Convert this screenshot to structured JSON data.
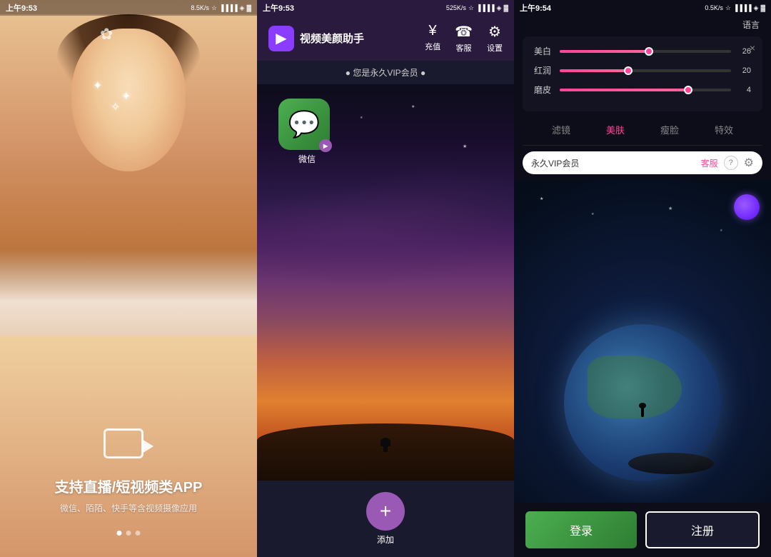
{
  "panel1": {
    "status_time": "上午9:53",
    "status_info": "8.5K/s",
    "title": "支持直播/短视频类APP",
    "subtitle": "微信、陌陌、快手等含视频摄像应用",
    "dots": [
      true,
      false,
      false
    ],
    "video_icon": "▶"
  },
  "panel2": {
    "status_time": "上午9:53",
    "status_info": "525K/s",
    "app_name": "视频美颜助手",
    "logo_icon": "▶",
    "actions": [
      {
        "icon": "¥",
        "label": "充值"
      },
      {
        "icon": "☎",
        "label": "客服"
      },
      {
        "icon": "⚙",
        "label": "设置"
      }
    ],
    "vip_text": "● 您是永久VIP会员 ●",
    "wechat_label": "微信",
    "add_label": "添加",
    "add_icon": "+"
  },
  "panel3": {
    "status_time": "上午9:54",
    "status_info": "0.5K/s",
    "lang": "语言",
    "close_icon": "×",
    "sliders": [
      {
        "label": "美白",
        "value": 26,
        "percent": 52
      },
      {
        "label": "红润",
        "value": 20,
        "percent": 40
      },
      {
        "label": "磨皮",
        "value": 4,
        "percent": 75
      }
    ],
    "tabs": [
      {
        "label": "滤镜",
        "active": false
      },
      {
        "label": "美肤",
        "active": true
      },
      {
        "label": "瘦脸",
        "active": false
      },
      {
        "label": "特效",
        "active": false
      }
    ],
    "vip_label": "永久VIP会员",
    "kefu_label": "客服",
    "help_icon": "?",
    "gear_icon": "⚙",
    "login_label": "登录",
    "register_label": "注册"
  }
}
